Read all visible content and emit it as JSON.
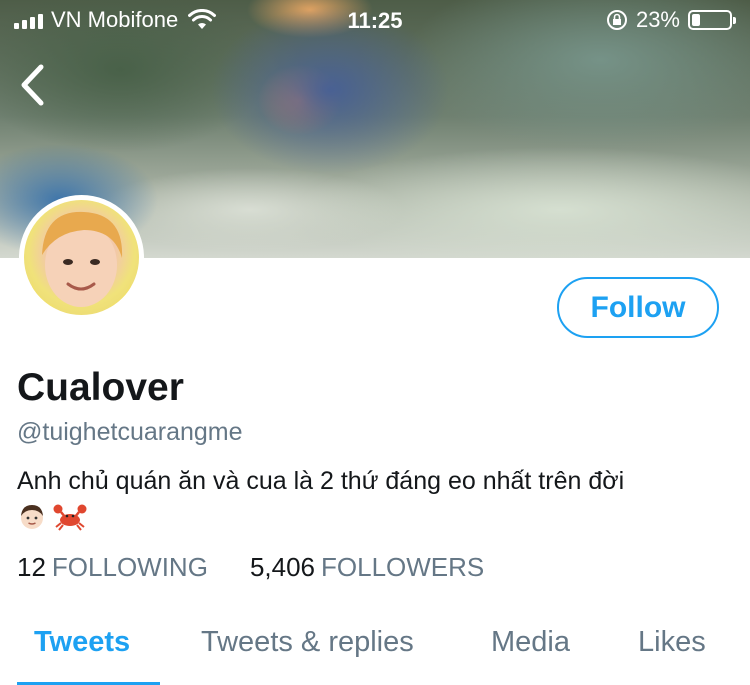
{
  "status_bar": {
    "carrier": "VN Mobifone",
    "time": "11:25",
    "battery_text": "23%",
    "battery_level": 0.23,
    "icons": [
      "signal-icon",
      "wifi-icon",
      "rotation-lock-icon",
      "battery-icon"
    ]
  },
  "nav": {
    "back_icon": "chevron-left-icon"
  },
  "profile": {
    "name": "Cualover",
    "handle": "@tuighetcuarangme",
    "bio": "Anh chủ quán ăn và cua là 2 thứ đáng eo nhất trên đời",
    "bio_emoji": [
      "👦🏻",
      "🦀"
    ],
    "follow_label": "Follow"
  },
  "stats": {
    "following_count": "12",
    "following_label": "FOLLOWING",
    "followers_count": "5,406",
    "followers_label": "FOLLOWERS"
  },
  "tabs": [
    {
      "label": "Tweets",
      "active": true
    },
    {
      "label": "Tweets & replies",
      "active": false
    },
    {
      "label": "Media",
      "active": false
    },
    {
      "label": "Likes",
      "active": false
    }
  ],
  "colors": {
    "accent": "#1da1f2",
    "text_primary": "#14171a",
    "text_secondary": "#657786"
  }
}
